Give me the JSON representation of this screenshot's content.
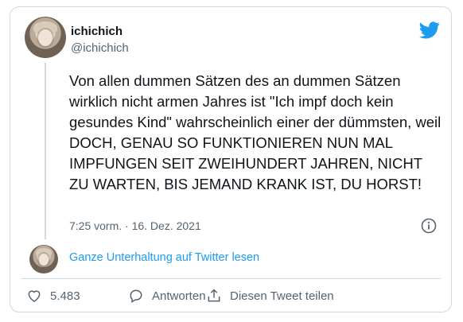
{
  "author": {
    "name": "ichichich",
    "handle": "@ichichich"
  },
  "tweet": {
    "text": "Von allen dummen Sätzen des an dummen Sätzen wirklich nicht armen Jahres ist \"Ich impf doch kein gesundes Kind\" wahrscheinlich einer der dümmsten, weil DOCH, GENAU SO FUNKTIONIEREN NUN MAL IMPFUNGEN SEIT ZWEIHUNDERT JAHREN, NICHT ZU WARTEN, BIS JEMAND KRANK IST, DU HORST!",
    "timestamp": "7:25 vorm. · 16. Dez. 2021"
  },
  "conversation": {
    "link_label": "Ganze Unterhaltung auf Twitter lesen"
  },
  "actions": {
    "like_count": "5.483",
    "reply_label": "Antworten",
    "share_label": "Diesen Tweet teilen"
  },
  "icons": {
    "brand": "twitter-bird-icon",
    "info": "info-icon",
    "like": "heart-icon",
    "reply": "comment-icon",
    "share": "share-icon"
  },
  "colors": {
    "accent": "#1d9bf0",
    "text": "#0f1419",
    "muted": "#536471",
    "border": "#cfd9de"
  }
}
